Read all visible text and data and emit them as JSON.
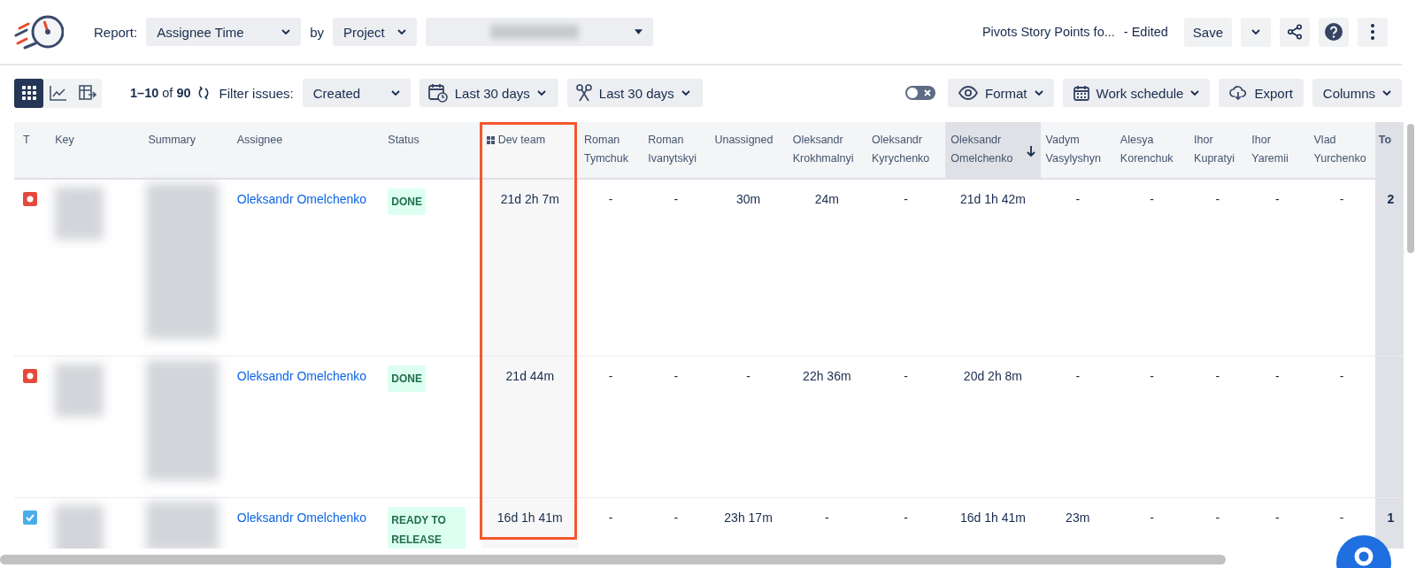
{
  "header": {
    "report_label": "Report:",
    "report_select": "Assignee Time",
    "by_label": "by",
    "group_select": "Project",
    "report_title": "Pivots Story Points fo...",
    "edited": "- Edited",
    "save": "Save"
  },
  "toolbar": {
    "view_modes": [
      {
        "kind": "grid",
        "selected": true
      },
      {
        "kind": "chart",
        "selected": false
      },
      {
        "kind": "pivot",
        "selected": false
      }
    ],
    "count": "**1–10** of **90**",
    "filter_label": "Filter issues:",
    "filter_select": "Created",
    "date_filters": [
      {
        "kind": "calendar",
        "label": "Last 30 days"
      },
      {
        "kind": "scissors",
        "label": "Last 30 days"
      }
    ],
    "toggle": {
      "on": false
    },
    "format": "Format",
    "work_schedule": "Work schedule",
    "export": "Export",
    "columns": "Columns"
  },
  "table": {
    "columns": [
      {
        "label": "T",
        "kind": "type"
      },
      {
        "label": "Key",
        "kind": "redacted"
      },
      {
        "label": "Summary",
        "kind": "redacted"
      },
      {
        "label": "Assignee",
        "kind": "link"
      },
      {
        "label": "Status",
        "kind": "status"
      },
      {
        "label": "Dev team",
        "kind": "time",
        "highlighted": true
      },
      {
        "label": "Roman Tymchuk",
        "kind": "time"
      },
      {
        "label": "Roman Ivanytskyi",
        "kind": "time"
      },
      {
        "label": "Unassigned",
        "kind": "time"
      },
      {
        "label": "Oleksandr Krokhmalnyi",
        "kind": "time"
      },
      {
        "label": "Oleksandr Kyrychenko",
        "kind": "time"
      },
      {
        "label": "Oleksandr Omelchenko",
        "kind": "time",
        "sorted": true
      },
      {
        "label": "Vadym Vasylyshyn",
        "kind": "time"
      },
      {
        "label": "Alesya Korenchuk",
        "kind": "time"
      },
      {
        "label": "Ihor Kupratyi",
        "kind": "time"
      },
      {
        "label": "Ihor Yaremii",
        "kind": "time"
      },
      {
        "label": "Vlad Yurchenko",
        "kind": "time"
      },
      {
        "label": "To",
        "kind": "total"
      }
    ],
    "rows": [
      {
        "kind": "bug",
        "assignee": "Oleksandr Omelchenko",
        "status": "DONE",
        "times": [
          "21d 2h 7m",
          "-",
          "-",
          "30m",
          "24m",
          "-",
          "21d 1h 42m",
          "-",
          "-",
          "-",
          "-",
          "-"
        ],
        "total": "2"
      },
      {
        "kind": "bug",
        "assignee": "Oleksandr Omelchenko",
        "status": "DONE",
        "times": [
          "21d 44m",
          "-",
          "-",
          "-",
          "22h 36m",
          "-",
          "20d 2h 8m",
          "-",
          "-",
          "-",
          "-",
          "-"
        ]
      },
      {
        "kind": "task",
        "assignee": "Oleksandr Omelchenko",
        "status": "READY TO RELEASE",
        "times": [
          "16d 1h 41m",
          "-",
          "-",
          "23h 17m",
          "-",
          "-",
          "16d 1h 41m",
          "23m",
          "-",
          "-",
          "-",
          "-"
        ],
        "total": "1"
      }
    ]
  }
}
